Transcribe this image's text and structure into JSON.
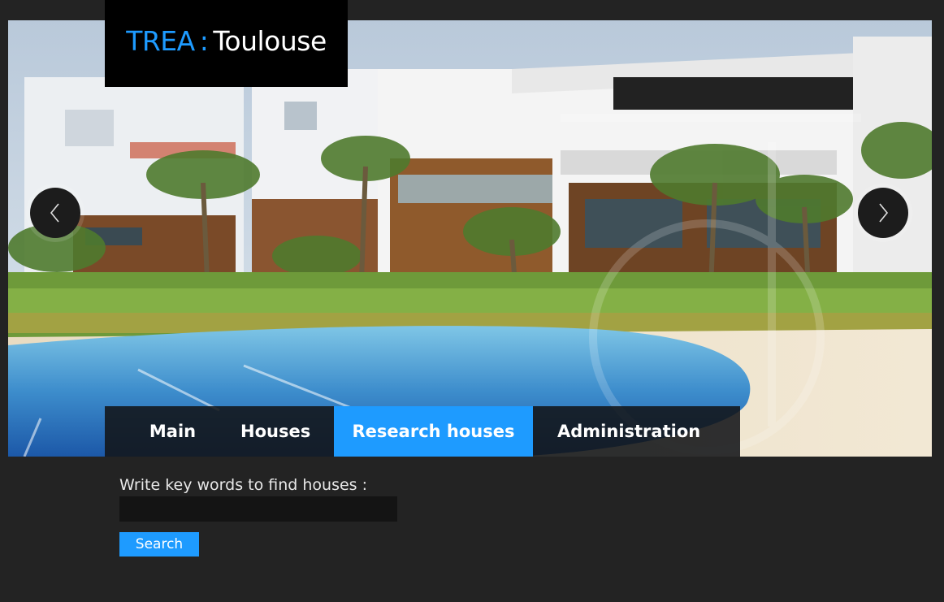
{
  "logo": {
    "accent_text": "TREA",
    "separator": ":",
    "city_text": "Toulouse"
  },
  "slider": {
    "image_alt": "Residential villas with palm trees and a swimming pool",
    "prev_icon": "chevron-left-icon",
    "next_icon": "chevron-right-icon"
  },
  "nav": {
    "items": [
      {
        "label": "Main",
        "active": false
      },
      {
        "label": "Houses",
        "active": false
      },
      {
        "label": "Research houses",
        "active": true
      },
      {
        "label": "Administration",
        "active": false
      }
    ]
  },
  "search": {
    "label": "Write key words to find houses :",
    "value": "",
    "placeholder": "",
    "button_label": "Search"
  },
  "colors": {
    "accent": "#1e9bff",
    "background": "#232323",
    "logo_bg": "#000000",
    "input_bg": "#141414"
  }
}
